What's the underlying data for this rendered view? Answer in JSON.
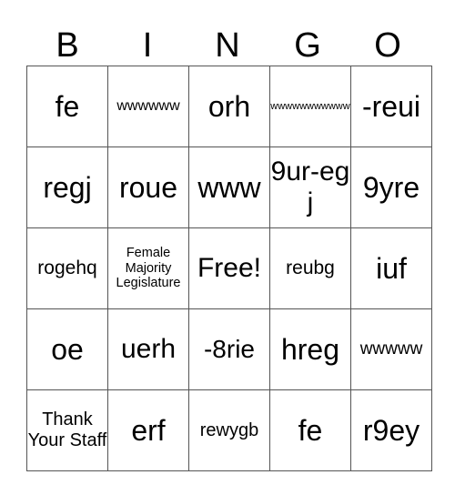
{
  "header": {
    "letters": [
      "B",
      "I",
      "N",
      "G",
      "O"
    ]
  },
  "grid": {
    "rows": [
      [
        "fe",
        "wwwwww",
        "orh",
        "wwwwwwwwwww",
        "-reui"
      ],
      [
        "regj",
        "roue",
        "www",
        "9ur-egj",
        "9yre"
      ],
      [
        "rogehq",
        "Female Majority Legislature",
        "Free!",
        "reubg",
        "iuf"
      ],
      [
        "oe",
        "uerh",
        "-8rie",
        "hreg",
        "wwwww"
      ],
      [
        "Thank Your Staff",
        "erf",
        "rewygb",
        "fe",
        "r9ey"
      ]
    ]
  }
}
